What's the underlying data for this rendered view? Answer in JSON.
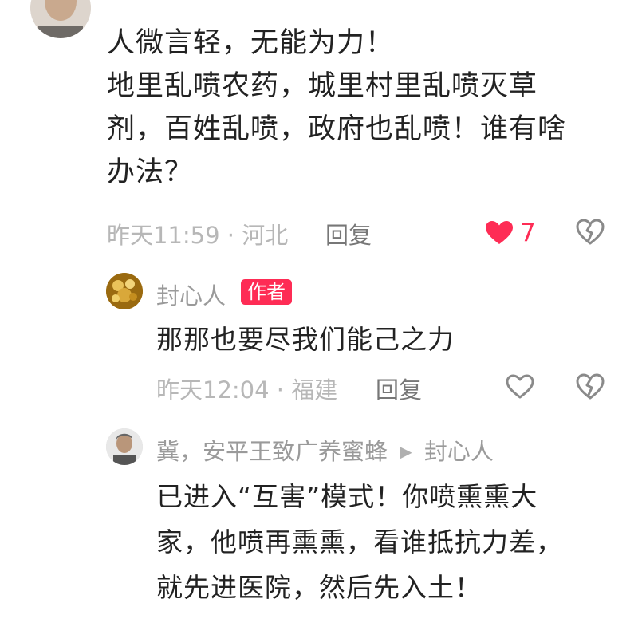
{
  "comment": {
    "lines": [
      "人微言轻，无能为力！",
      "地里乱喷农药，城里村里乱喷灭草",
      "剂，百姓乱喷，政府也乱喷！谁有啥",
      "办法？"
    ],
    "time": "昨天11:59",
    "location": "河北",
    "reply_label": "回复",
    "like_count": "7",
    "liked": true,
    "icons": {
      "like": "heart-icon-filled",
      "dislike": "broken-heart-icon"
    }
  },
  "reply1": {
    "username": "封心人",
    "badge": "作者",
    "text": "那那也要尽我们能己之力",
    "time": "昨天12:04",
    "location": "福建",
    "reply_label": "回复",
    "icons": {
      "like": "heart-icon",
      "dislike": "broken-heart-icon"
    }
  },
  "reply2": {
    "username": "冀，安平王致广养蜜蜂",
    "reply_to": "封心人",
    "lines": [
      "已进入“互害”模式！你喷熏熏大",
      "家，他喷再熏熏，看谁抵抗力差，",
      "就先进医院，然后先入土！"
    ]
  },
  "separator": "·",
  "colors": {
    "accent": "#fe2c55",
    "text": "#222222",
    "meta": "#b7b7b7"
  }
}
